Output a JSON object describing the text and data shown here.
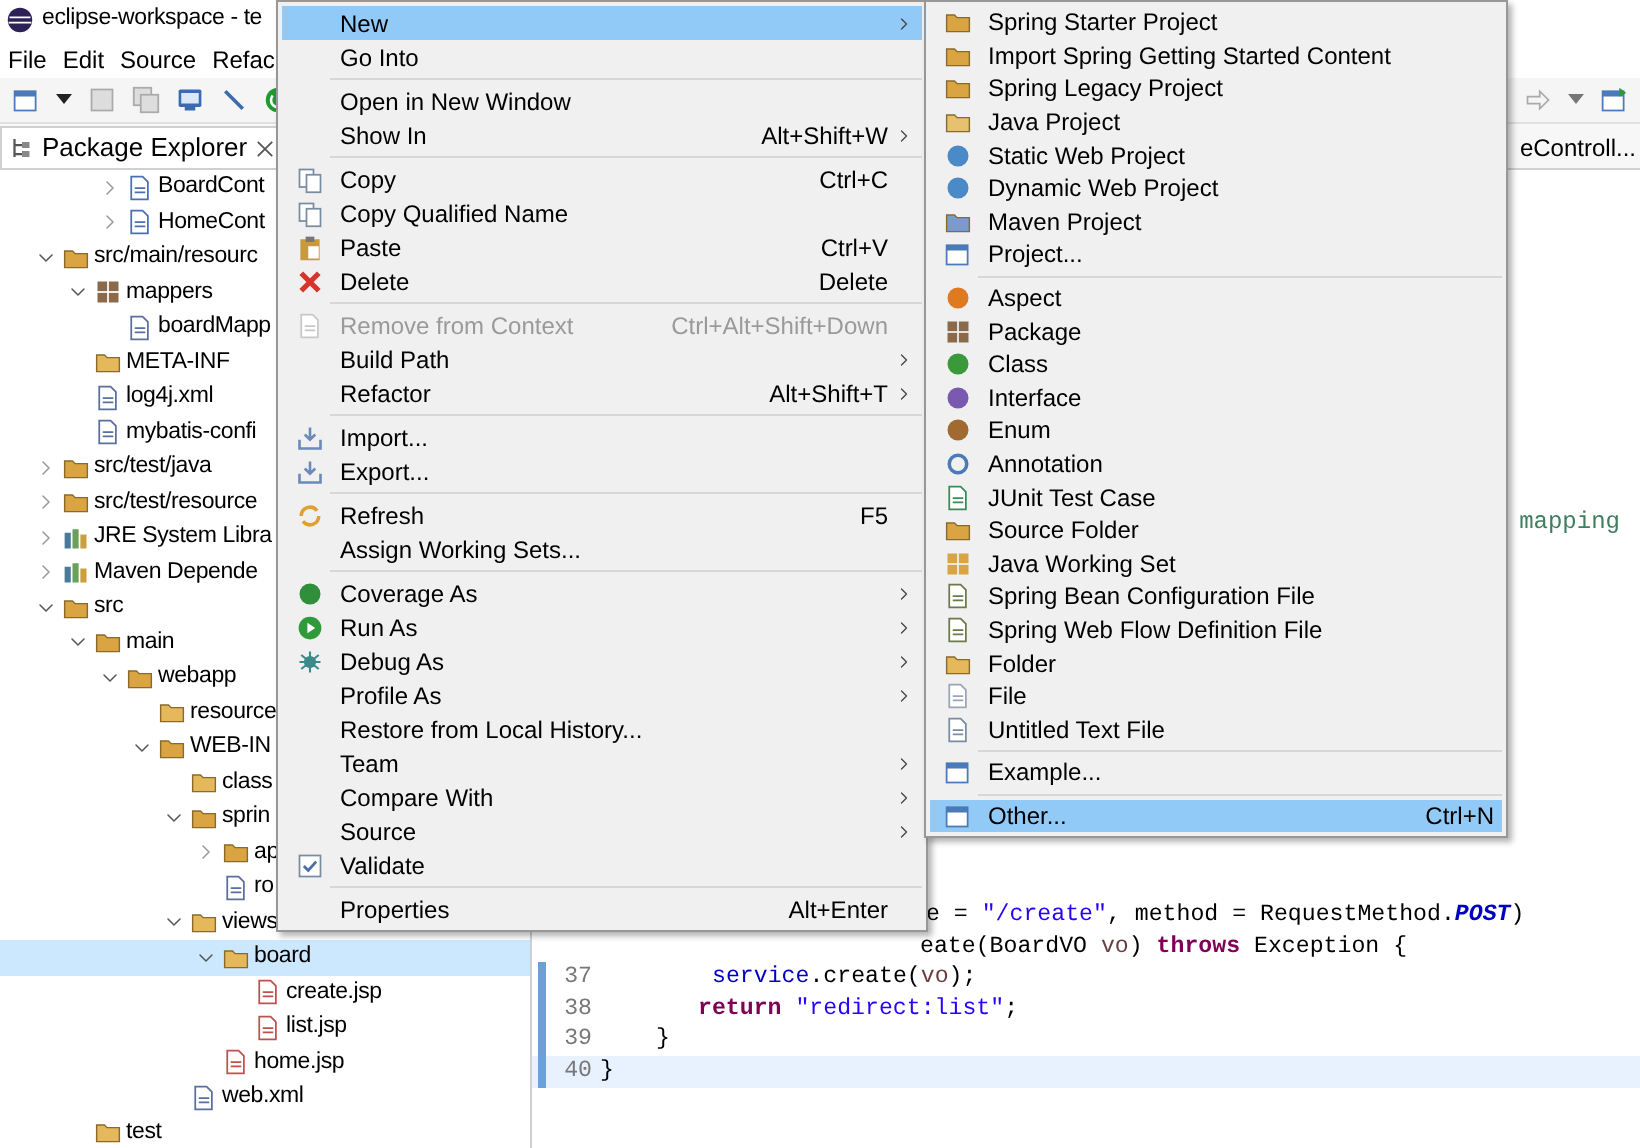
{
  "window": {
    "title": "eclipse-workspace - te"
  },
  "menu_bar": [
    "File",
    "Edit",
    "Source",
    "Refac"
  ],
  "package_explorer": {
    "tab": "Package Explorer",
    "tree": {
      "partial_items": [
        {
          "label": "BoardCont",
          "kind": "java",
          "expanded": false,
          "selected": false
        },
        {
          "label": "HomeCont",
          "kind": "java",
          "expanded": false,
          "selected": false
        }
      ],
      "items": [
        {
          "label": "src/main/resourc",
          "kind": "srcfolder",
          "expanded": true,
          "selected": false,
          "children": [
            {
              "label": "mappers",
              "kind": "package",
              "expanded": true,
              "selected": false,
              "children": [
                {
                  "label": "boardMapp",
                  "kind": "xml",
                  "selected": false
                }
              ]
            },
            {
              "label": "META-INF",
              "kind": "folder",
              "selected": false
            },
            {
              "label": "log4j.xml",
              "kind": "xml",
              "selected": false
            },
            {
              "label": "mybatis-confi",
              "kind": "xml",
              "selected": false
            }
          ]
        },
        {
          "label": "src/test/java",
          "kind": "srcfolder",
          "expanded": false,
          "selected": false
        },
        {
          "label": "src/test/resource",
          "kind": "srcfolder",
          "expanded": false,
          "selected": false
        },
        {
          "label": "JRE System Libra",
          "kind": "library",
          "expanded": false,
          "selected": false
        },
        {
          "label": "Maven Depende",
          "kind": "library",
          "expanded": false,
          "selected": false
        },
        {
          "label": "src",
          "kind": "srcfolder",
          "expanded": true,
          "selected": false,
          "children": [
            {
              "label": "main",
              "kind": "srcfolder",
              "expanded": true,
              "selected": false,
              "children": [
                {
                  "label": "webapp",
                  "kind": "srcfolder",
                  "expanded": true,
                  "selected": false,
                  "children": [
                    {
                      "label": "resource",
                      "kind": "folder",
                      "selected": false
                    },
                    {
                      "label": "WEB-IN",
                      "kind": "srcfolder",
                      "expanded": true,
                      "selected": false,
                      "children": [
                        {
                          "label": "class",
                          "kind": "folder",
                          "selected": false
                        },
                        {
                          "label": "sprin",
                          "kind": "srcfolder",
                          "expanded": true,
                          "selected": false,
                          "children": [
                            {
                              "label": "ap",
                              "kind": "srcfolder",
                              "expanded": false,
                              "selected": false
                            },
                            {
                              "label": "ro",
                              "kind": "xml",
                              "selected": false
                            }
                          ]
                        },
                        {
                          "label": "views",
                          "kind": "folder",
                          "expanded": true,
                          "selected": false,
                          "children": [
                            {
                              "label": "board",
                              "kind": "folder",
                              "expanded": true,
                              "selected": true,
                              "children": [
                                {
                                  "label": "create.jsp",
                                  "kind": "jsp",
                                  "selected": false
                                },
                                {
                                  "label": "list.jsp",
                                  "kind": "jsp",
                                  "selected": false
                                }
                              ]
                            },
                            {
                              "label": "home.jsp",
                              "kind": "jsp",
                              "selected": false
                            }
                          ]
                        },
                        {
                          "label": "web.xml",
                          "kind": "xml",
                          "selected": false
                        }
                      ]
                    }
                  ]
                }
              ]
            },
            {
              "label": "test",
              "kind": "folder",
              "selected": false
            }
          ]
        }
      ]
    }
  },
  "editor": {
    "tab": "eControll...",
    "fragment": "mapping",
    "lines": [
      {
        "changed": false,
        "current": false,
        "tokens": [
          {
            "kind": "plain",
            "text": "e = "
          },
          {
            "kind": "string",
            "text": "\"/create\""
          },
          {
            "kind": "plain",
            "text": ", method = RequestMethod."
          },
          {
            "kind": "constant",
            "text": "POST"
          },
          {
            "kind": "plain",
            "text": ")"
          }
        ]
      },
      {
        "changed": false,
        "current": false,
        "tokens": [
          {
            "kind": "plain",
            "text": "eate(BoardVO "
          },
          {
            "kind": "param",
            "text": "vo"
          },
          {
            "kind": "plain",
            "text": ") "
          },
          {
            "kind": "keyword",
            "text": "throws"
          },
          {
            "kind": "plain",
            "text": " Exception {"
          }
        ]
      },
      {
        "number": "37",
        "changed": true,
        "current": false,
        "tokens": [
          {
            "kind": "field",
            "text": "service"
          },
          {
            "kind": "plain",
            "text": ".create("
          },
          {
            "kind": "param",
            "text": "vo"
          },
          {
            "kind": "plain",
            "text": ");"
          }
        ]
      },
      {
        "number": "38",
        "changed": true,
        "current": false,
        "tokens": [
          {
            "kind": "keyword",
            "text": "return"
          },
          {
            "kind": "string",
            "text": " \"redirect:list\""
          },
          {
            "kind": "plain",
            "text": ";"
          }
        ]
      },
      {
        "number": "39",
        "changed": true,
        "current": false,
        "tokens": [
          {
            "kind": "plain",
            "text": "}"
          }
        ]
      },
      {
        "number": "40",
        "changed": true,
        "current": true,
        "tokens": [
          {
            "kind": "plain",
            "text": "}"
          }
        ]
      }
    ]
  },
  "context_menu": {
    "groups": [
      [
        {
          "label": "New",
          "submenu": true,
          "disabled": false,
          "selected": true
        },
        {
          "label": "Go Into",
          "submenu": false,
          "disabled": false,
          "selected": false
        }
      ],
      [
        {
          "label": "Open in New Window",
          "submenu": false,
          "disabled": false,
          "selected": false
        },
        {
          "label": "Show In",
          "shortcut": "Alt+Shift+W",
          "submenu": true,
          "disabled": false,
          "selected": false
        }
      ],
      [
        {
          "label": "Copy",
          "kind": "copy",
          "shortcut": "Ctrl+C",
          "submenu": false,
          "disabled": false,
          "selected": false
        },
        {
          "label": "Copy Qualified Name",
          "kind": "copy",
          "submenu": false,
          "disabled": false,
          "selected": false
        },
        {
          "label": "Paste",
          "kind": "paste",
          "shortcut": "Ctrl+V",
          "submenu": false,
          "disabled": false,
          "selected": false
        },
        {
          "label": "Delete",
          "kind": "delete",
          "shortcut": "Delete",
          "submenu": false,
          "disabled": false,
          "selected": false
        }
      ],
      [
        {
          "label": "Remove from Context",
          "kind": "remove",
          "shortcut": "Ctrl+Alt+Shift+Down",
          "submenu": false,
          "disabled": true,
          "selected": false
        },
        {
          "label": "Build Path",
          "submenu": true,
          "disabled": false,
          "selected": false
        },
        {
          "label": "Refactor",
          "shortcut": "Alt+Shift+T",
          "submenu": true,
          "disabled": false,
          "selected": false
        }
      ],
      [
        {
          "label": "Import...",
          "kind": "import",
          "submenu": false,
          "disabled": false,
          "selected": false
        },
        {
          "label": "Export...",
          "kind": "export",
          "submenu": false,
          "disabled": false,
          "selected": false
        }
      ],
      [
        {
          "label": "Refresh",
          "kind": "refresh",
          "shortcut": "F5",
          "submenu": false,
          "disabled": false,
          "selected": false
        },
        {
          "label": "Assign Working Sets...",
          "submenu": false,
          "disabled": false,
          "selected": false
        }
      ],
      [
        {
          "label": "Coverage As",
          "kind": "coverage",
          "submenu": true,
          "disabled": false,
          "selected": false
        },
        {
          "label": "Run As",
          "kind": "run",
          "submenu": true,
          "disabled": false,
          "selected": false
        },
        {
          "label": "Debug As",
          "kind": "debug",
          "submenu": true,
          "disabled": false,
          "selected": false
        },
        {
          "label": "Profile As",
          "submenu": true,
          "disabled": false,
          "selected": false
        },
        {
          "label": "Restore from Local History...",
          "submenu": false,
          "disabled": false,
          "selected": false
        },
        {
          "label": "Team",
          "submenu": true,
          "disabled": false,
          "selected": false
        },
        {
          "label": "Compare With",
          "submenu": true,
          "disabled": false,
          "selected": false
        },
        {
          "label": "Source",
          "submenu": true,
          "disabled": false,
          "selected": false
        },
        {
          "label": "Validate",
          "kind": "validate",
          "submenu": false,
          "disabled": false,
          "selected": false
        }
      ],
      [
        {
          "label": "Properties",
          "shortcut": "Alt+Enter",
          "submenu": false,
          "disabled": false,
          "selected": false
        }
      ]
    ]
  },
  "new_submenu": {
    "groups": [
      [
        {
          "label": "Spring Starter Project",
          "kind": "spring-project",
          "selected": false
        },
        {
          "label": "Import Spring Getting Started Content",
          "kind": "spring-project",
          "selected": false
        },
        {
          "label": "Spring Legacy Project",
          "kind": "spring-project",
          "selected": false
        },
        {
          "label": "Java Project",
          "kind": "java-project",
          "selected": false
        },
        {
          "label": "Static Web Project",
          "kind": "web-project",
          "selected": false
        },
        {
          "label": "Dynamic Web Project",
          "kind": "web-project",
          "selected": false
        },
        {
          "label": "Maven Project",
          "kind": "maven",
          "selected": false
        },
        {
          "label": "Project...",
          "kind": "wizard",
          "selected": false
        }
      ],
      [
        {
          "label": "Aspect",
          "kind": "aspect",
          "selected": false
        },
        {
          "label": "Package",
          "kind": "package",
          "selected": false
        },
        {
          "label": "Class",
          "kind": "class",
          "selected": false
        },
        {
          "label": "Interface",
          "kind": "interface",
          "selected": false
        },
        {
          "label": "Enum",
          "kind": "enum",
          "selected": false
        },
        {
          "label": "Annotation",
          "kind": "annotation",
          "selected": false
        },
        {
          "label": "JUnit Test Case",
          "kind": "junit",
          "selected": false
        },
        {
          "label": "Source Folder",
          "kind": "srcfolder",
          "selected": false
        },
        {
          "label": "Java Working Set",
          "kind": "working-set",
          "selected": false
        },
        {
          "label": "Spring Bean Configuration File",
          "kind": "spring-file",
          "selected": false
        },
        {
          "label": "Spring Web Flow Definition File",
          "kind": "spring-file",
          "selected": false
        },
        {
          "label": "Folder",
          "kind": "folder",
          "selected": false
        },
        {
          "label": "File",
          "kind": "file",
          "selected": false
        },
        {
          "label": "Untitled Text File",
          "kind": "text-file",
          "selected": false
        }
      ],
      [
        {
          "label": "Example...",
          "kind": "wizard",
          "selected": false
        }
      ],
      [
        {
          "label": "Other...",
          "kind": "wizard",
          "shortcut": "Ctrl+N",
          "selected": true
        }
      ]
    ]
  }
}
